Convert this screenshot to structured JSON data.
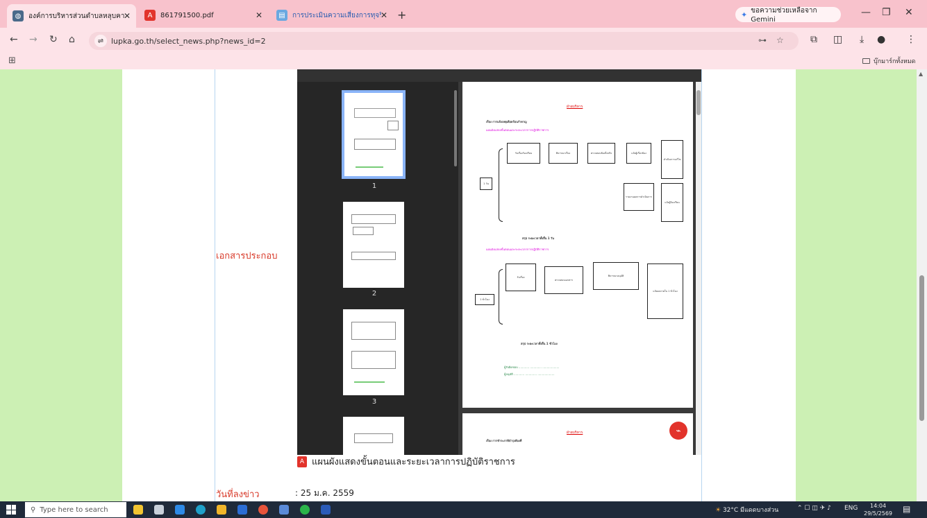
{
  "tabs": [
    {
      "title": "องค์การบริหารส่วนตำบลหลุบคา อำเภ",
      "active": true,
      "icon": "globe-icon"
    },
    {
      "title": "861791500.pdf",
      "active": false,
      "icon": "pdf-icon"
    },
    {
      "title": "การประเมินความเสี่ยงการทุจริตในการ",
      "active": false,
      "icon": "site-icon"
    }
  ],
  "gemini_label": "ขอความช่วยเหลือจาก Gemini",
  "url": "lupka.go.th/select_news.php?news_id=2",
  "bookmark_folder": "บุ๊กมาร์กทั้งหมด",
  "page": {
    "attachment_label": "เอกสารประกอบ",
    "pdf_caption": "แผนผังแสดงขั้นตอนและระยะเวลาการปฏิบัติราชการ",
    "date_label": "วันที่ลงข่าว",
    "date_value": ": 25 ม.ค. 2559"
  },
  "pdf": {
    "thumbnail_numbers": [
      "1",
      "2",
      "3"
    ],
    "page1": {
      "header": "ฝ่ายบริหาร",
      "title_line": "เรื่อง  การแจ้งเหตุเดือดร้อนรำคาญ",
      "subtitle": "แผนผังแสดงขั้นตอนและระยะเวลาการปฏิบัติราชการ",
      "flow1_side": "1 วัน",
      "flow1_boxes": [
        "รับเรื่องร้องเรียน",
        "พิจารณาเรื่อง",
        "ตรวจสอบข้อเท็จจริง",
        "แจ้งผู้เกี่ยวข้อง",
        "ดำเนินการแก้ไข"
      ],
      "flow1_lower": [
        "รายงานผลการดำเนินการ",
        "แจ้งผู้ร้องเรียน"
      ],
      "sum1": "สรุป  ระยะเวลาทั้งสิ้น  1  วัน",
      "subtitle2": "แผนผังแสดงขั้นตอนและระยะเวลาการปฏิบัติราชการ",
      "flow2_side": "1 ชั่วโมง",
      "flow2_boxes": [
        "รับเรื่อง",
        "ตรวจสอบเอกสาร",
        "พิจารณาอนุมัติ",
        "แจ้งผลภายใน 1 ชั่วโมง"
      ],
      "sum2": "สรุป  ระยะเวลาทั้งสิ้น  1  ชั่วโมง",
      "footer1": "ผู้รับผิดชอบ ............  .............  ...................",
      "footer2": "ผู้อนุมัติ ............  .............  ..................."
    },
    "page2": {
      "header": "ฝ่ายบริหาร",
      "title_line": "เรื่อง  การชำระภาษีบำรุงท้องที่"
    }
  },
  "taskbar": {
    "search_placeholder": "Type here to search",
    "weather": "32°C  มีแดดบางส่วน",
    "lang": "ENG",
    "time": "14:04",
    "date": "29/5/2569"
  }
}
